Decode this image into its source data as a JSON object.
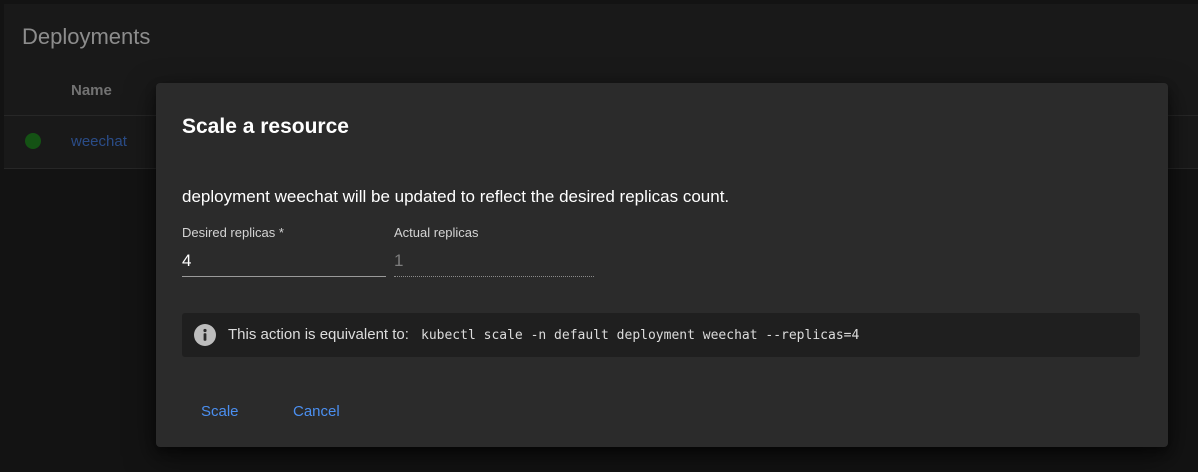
{
  "background": {
    "card_title": "Deployments",
    "table": {
      "columns": [
        "Name"
      ],
      "rows": [
        {
          "name": "weechat",
          "status_color": "#1e7a1e"
        }
      ]
    }
  },
  "dialog": {
    "title": "Scale a resource",
    "message": "deployment weechat will be updated to reflect the desired replicas count.",
    "desired": {
      "label": "Desired replicas *",
      "value": "4"
    },
    "actual": {
      "label": "Actual replicas",
      "value": "1"
    },
    "info": {
      "icon": "info-icon",
      "text": "This action is equivalent to:",
      "command": "kubectl scale -n default deployment weechat --replicas=4"
    },
    "buttons": {
      "scale": "Scale",
      "cancel": "Cancel"
    }
  },
  "colors": {
    "accent": "#4b8ff0",
    "link": "#3f70c8",
    "status_ok": "#1e7a1e"
  }
}
